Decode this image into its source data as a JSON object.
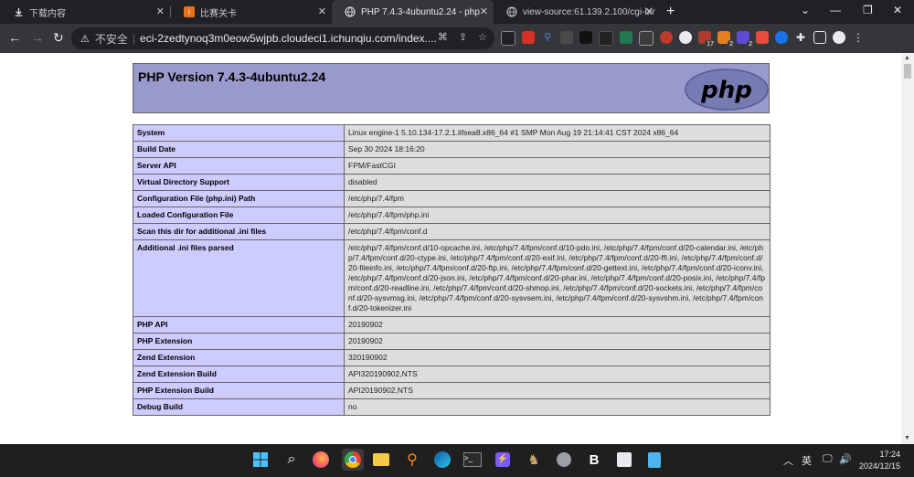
{
  "browser": {
    "tabs": [
      {
        "title": "下载内容",
        "active": false
      },
      {
        "title": "比赛关卡",
        "active": false
      },
      {
        "title": "PHP 7.4.3-4ubuntu2.24 - phpinfo()",
        "active": true
      },
      {
        "title": "view-source:61.139.2.100/cgi-bin",
        "active": false
      }
    ],
    "new_tab_label": "+",
    "omnibox": {
      "insecure_label": "不安全",
      "url": "eci-2zedtynoq3m0eow5wjpb.cloudeci1.ichunqiu.com/index...."
    },
    "extension_badges": [
      "17",
      "2",
      "2"
    ],
    "colors": {
      "chrome_dark": "#202124",
      "toolbar": "#35363a"
    }
  },
  "php": {
    "title": "PHP Version 7.4.3-4ubuntu2.24",
    "logo_text": "php",
    "rows": [
      {
        "label": "System",
        "value": "Linux engine-1 5.10.134-17.2.1.lifsea8.x86_64 #1 SMP Mon Aug 19 21:14:41 CST 2024 x86_64"
      },
      {
        "label": "Build Date",
        "value": "Sep 30 2024 18:16:20"
      },
      {
        "label": "Server API",
        "value": "FPM/FastCGI"
      },
      {
        "label": "Virtual Directory Support",
        "value": "disabled"
      },
      {
        "label": "Configuration File (php.ini) Path",
        "value": "/etc/php/7.4/fpm"
      },
      {
        "label": "Loaded Configuration File",
        "value": "/etc/php/7.4/fpm/php.ini"
      },
      {
        "label": "Scan this dir for additional .ini files",
        "value": "/etc/php/7.4/fpm/conf.d"
      },
      {
        "label": "Additional .ini files parsed",
        "value": "/etc/php/7.4/fpm/conf.d/10-opcache.ini, /etc/php/7.4/fpm/conf.d/10-pdo.ini, /etc/php/7.4/fpm/conf.d/20-calendar.ini, /etc/php/7.4/fpm/conf.d/20-ctype.ini, /etc/php/7.4/fpm/conf.d/20-exif.ini, /etc/php/7.4/fpm/conf.d/20-ffi.ini, /etc/php/7.4/fpm/conf.d/20-fileinfo.ini, /etc/php/7.4/fpm/conf.d/20-ftp.ini, /etc/php/7.4/fpm/conf.d/20-gettext.ini, /etc/php/7.4/fpm/conf.d/20-iconv.ini, /etc/php/7.4/fpm/conf.d/20-json.ini, /etc/php/7.4/fpm/conf.d/20-phar.ini, /etc/php/7.4/fpm/conf.d/20-posix.ini, /etc/php/7.4/fpm/conf.d/20-readline.ini, /etc/php/7.4/fpm/conf.d/20-shmop.ini, /etc/php/7.4/fpm/conf.d/20-sockets.ini, /etc/php/7.4/fpm/conf.d/20-sysvmsg.ini, /etc/php/7.4/fpm/conf.d/20-sysvsem.ini, /etc/php/7.4/fpm/conf.d/20-sysvshm.ini, /etc/php/7.4/fpm/conf.d/20-tokenizer.ini"
      },
      {
        "label": "PHP API",
        "value": "20190902"
      },
      {
        "label": "PHP Extension",
        "value": "20190902"
      },
      {
        "label": "Zend Extension",
        "value": "320190902"
      },
      {
        "label": "Zend Extension Build",
        "value": "API320190902,NTS"
      },
      {
        "label": "PHP Extension Build",
        "value": "API20190902,NTS"
      },
      {
        "label": "Debug Build",
        "value": "no"
      }
    ],
    "colors": {
      "header": "#9999cc",
      "label_cell": "#ccccff",
      "value_cell": "#dddddd"
    }
  },
  "taskbar": {
    "ime": "英",
    "time": "17:24",
    "date": "2024/12/15"
  }
}
